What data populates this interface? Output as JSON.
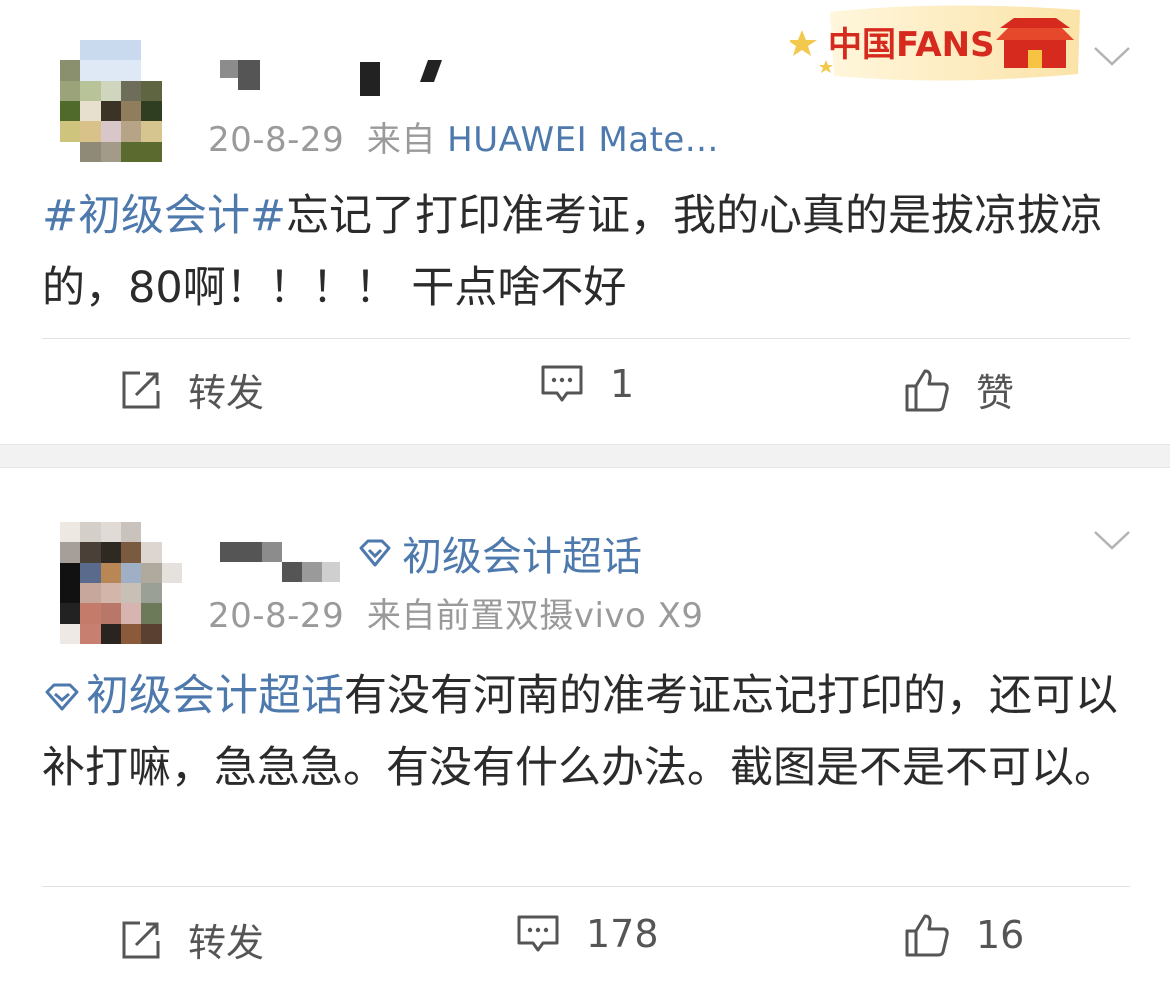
{
  "badge": {
    "text": "中国FANS"
  },
  "posts": [
    {
      "date": "20-8-29",
      "source_prefix": "来自",
      "device": "HUAWEI Mate...",
      "hashtag": "#初级会计#",
      "text": "忘记了打印准考证，我的心真的是拔凉拔凉的，80啊！！！！ 干点啥不好",
      "actions": {
        "repost": "转发",
        "comments": "1",
        "likes": "赞"
      }
    },
    {
      "super_topic": "初级会计超话",
      "date": "20-8-29",
      "source": "来自前置双摄vivo X9",
      "topic_link": "初级会计超话",
      "text": "有没有河南的准考证忘记打印的，还可以补打嘛，急急急。有没有什么办法。截图是不是不可以。",
      "actions": {
        "repost": "转发",
        "comments": "178",
        "likes": "16"
      }
    }
  ],
  "colors": {
    "link": "#4e79ad",
    "meta": "#9a9a9a",
    "divider": "#f2f2f2"
  }
}
